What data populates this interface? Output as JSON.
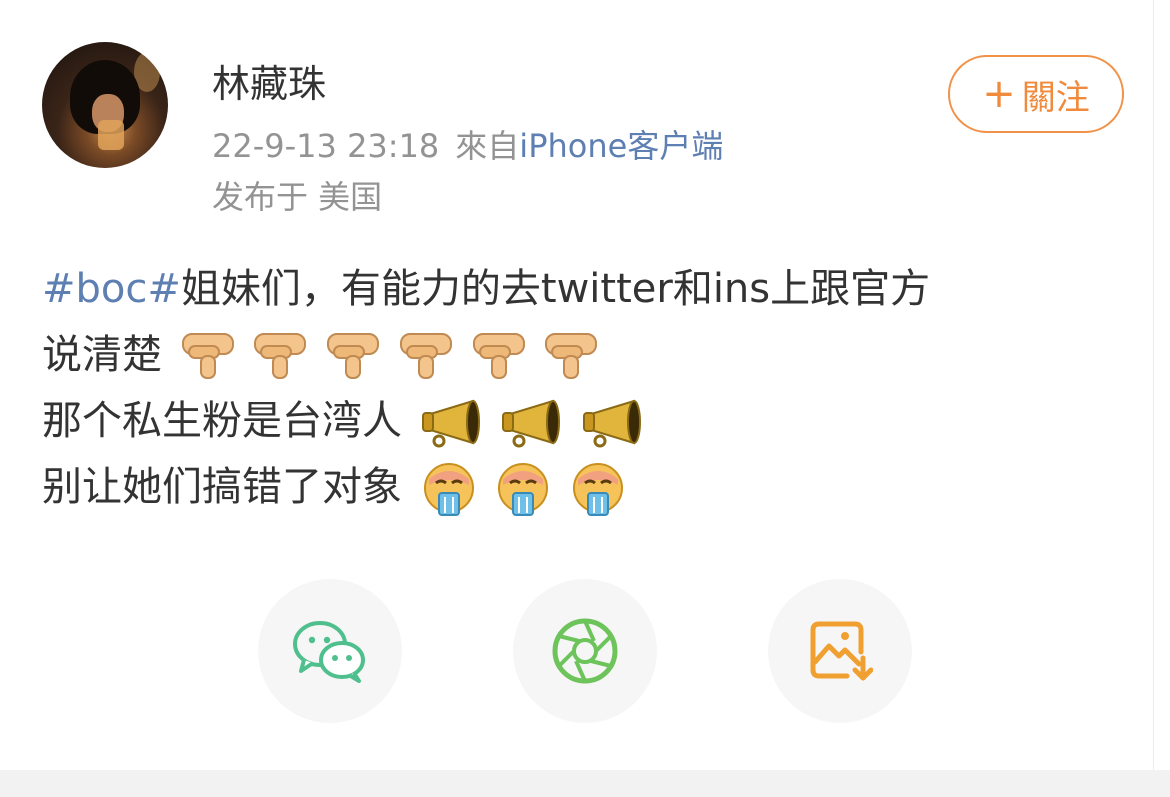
{
  "post": {
    "author_name": "林藏珠",
    "timestamp": "22-9-13 23:18",
    "source_prefix": "來自",
    "source_name": "iPhone客户端",
    "location": "发布于 美国",
    "follow_button": {
      "icon": "plus-icon",
      "label": "關注"
    },
    "content": {
      "hashtag": "#boc#",
      "line1_text": "姐妹们，有能力的去twitter和ins上跟官方",
      "line2_text": "说清楚",
      "line2_emojis": [
        "thumbs-down-icon",
        "thumbs-down-icon",
        "thumbs-down-icon",
        "thumbs-down-icon",
        "thumbs-down-icon",
        "thumbs-down-icon"
      ],
      "line3_text": "那个私生粉是台湾人",
      "line3_emojis": [
        "megaphone-icon",
        "megaphone-icon",
        "megaphone-icon"
      ],
      "line4_text": "别让她们搞错了对象",
      "line4_emojis": [
        "vomiting-face-icon",
        "vomiting-face-icon",
        "vomiting-face-icon"
      ]
    }
  },
  "share_actions": [
    {
      "icon": "wechat-icon",
      "color": "#4fc08d"
    },
    {
      "icon": "moments-aperture-icon",
      "color": "#6cc45a"
    },
    {
      "icon": "save-image-icon",
      "color": "#f0a030"
    }
  ],
  "colors": {
    "link_blue": "#5e7fb2",
    "meta_gray": "#939393",
    "follow_orange": "#f08a3c",
    "text": "#333333"
  }
}
